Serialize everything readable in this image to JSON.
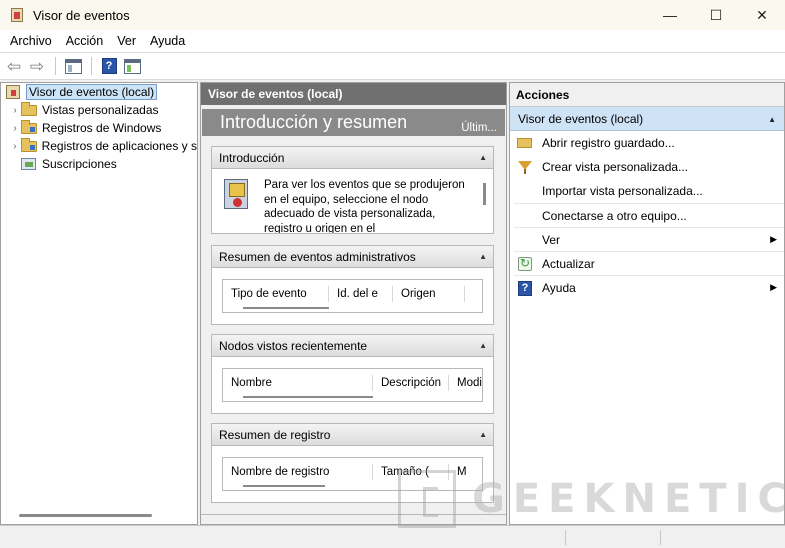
{
  "window": {
    "title": "Visor de eventos",
    "controls": {
      "minimize": "—",
      "maximize": "☐",
      "close": "✕"
    }
  },
  "menu": [
    "Archivo",
    "Acción",
    "Ver",
    "Ayuda"
  ],
  "toolbar": {
    "back_icon": "back-arrow-icon",
    "forward_icon": "forward-arrow-icon",
    "help_glyph": "?"
  },
  "tree": {
    "root": "Visor de eventos (local)",
    "items": [
      "Vistas personalizadas",
      "Registros de Windows",
      "Registros de aplicaciones y s",
      "Suscripciones"
    ]
  },
  "middle": {
    "header": "Visor de eventos (local)",
    "banner_title": "Introducción y resumen",
    "banner_last": "Últim...",
    "sections": {
      "intro": {
        "title": "Introducción",
        "text": "Para ver los eventos que se produjeron en el equipo, seleccione el nodo adecuado de vista personalizada, registro u origen en el"
      },
      "admin": {
        "title": "Resumen de eventos administrativos",
        "columns": [
          "Tipo de evento",
          "Id. del e",
          "Origen"
        ]
      },
      "recent": {
        "title": "Nodos vistos recientemente",
        "columns": [
          "Nombre",
          "Descripción",
          "Modi"
        ]
      },
      "log": {
        "title": "Resumen de registro",
        "columns": [
          "Nombre de registro",
          "Tamaño (",
          "M"
        ]
      }
    }
  },
  "actions": {
    "header": "Acciones",
    "subheader": "Visor de eventos (local)",
    "items": [
      {
        "label": "Abrir registro guardado...",
        "icon": "open-folder-icon"
      },
      {
        "label": "Crear vista personalizada...",
        "icon": "filter-icon"
      },
      {
        "label": "Importar vista personalizada...",
        "icon": ""
      },
      {
        "label": "Conectarse a otro equipo...",
        "icon": ""
      },
      {
        "label": "Ver",
        "icon": "",
        "submenu": true
      },
      {
        "label": "Actualizar",
        "icon": "refresh-icon"
      },
      {
        "label": "Ayuda",
        "icon": "help-icon",
        "submenu": true
      }
    ]
  },
  "watermark": "GEEKNETIC"
}
